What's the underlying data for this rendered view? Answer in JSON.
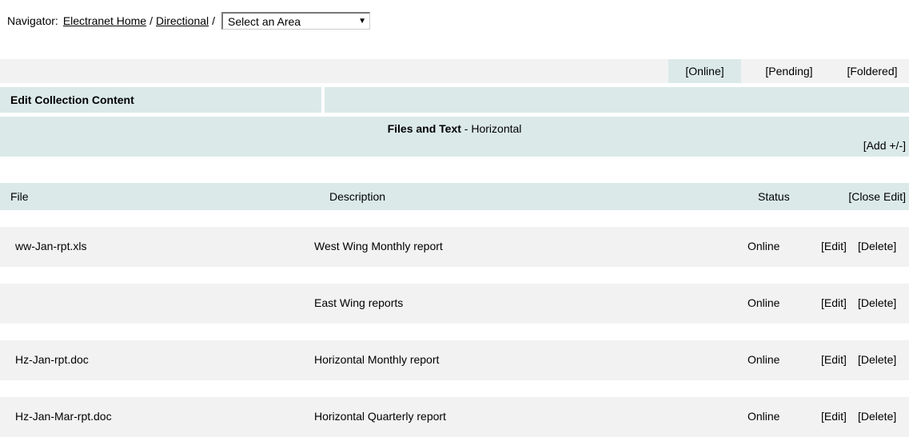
{
  "navigator": {
    "label": "Navigator:",
    "breadcrumbs": [
      "Electranet Home",
      "Directional"
    ],
    "separator": "/",
    "area_select": {
      "value": "Select an Area",
      "arrow_icon": "dropdown-arrow-icon"
    }
  },
  "status_tabs": [
    "[Online]",
    "[Pending]",
    "[Foldered]"
  ],
  "section": {
    "title": "Edit Collection Content",
    "collection_title_bold": "Files and Text",
    "collection_title_rest": " - Horizontal",
    "add_label": "[Add +/-]"
  },
  "table": {
    "columns": [
      "File",
      "Description",
      "Status",
      "[Close Edit]"
    ],
    "rows": [
      {
        "file": "ww-Jan-rpt.xls",
        "description": "West Wing Monthly report",
        "status": "Online",
        "edit": "[Edit]",
        "delete": "[Delete]"
      },
      {
        "file": "",
        "description": "East Wing reports",
        "status": "Online",
        "edit": "[Edit]",
        "delete": "[Delete]"
      },
      {
        "file": "Hz-Jan-rpt.doc",
        "description": "Horizontal Monthly report",
        "status": "Online",
        "edit": "[Edit]",
        "delete": "[Delete]"
      },
      {
        "file": "Hz-Jan-Mar-rpt.doc",
        "description": "Horizontal Quarterly report",
        "status": "Online",
        "edit": "[Edit]",
        "delete": "[Delete]"
      }
    ]
  },
  "colors": {
    "band": "#dbe9e9",
    "row_band": "#f2f2f2"
  }
}
